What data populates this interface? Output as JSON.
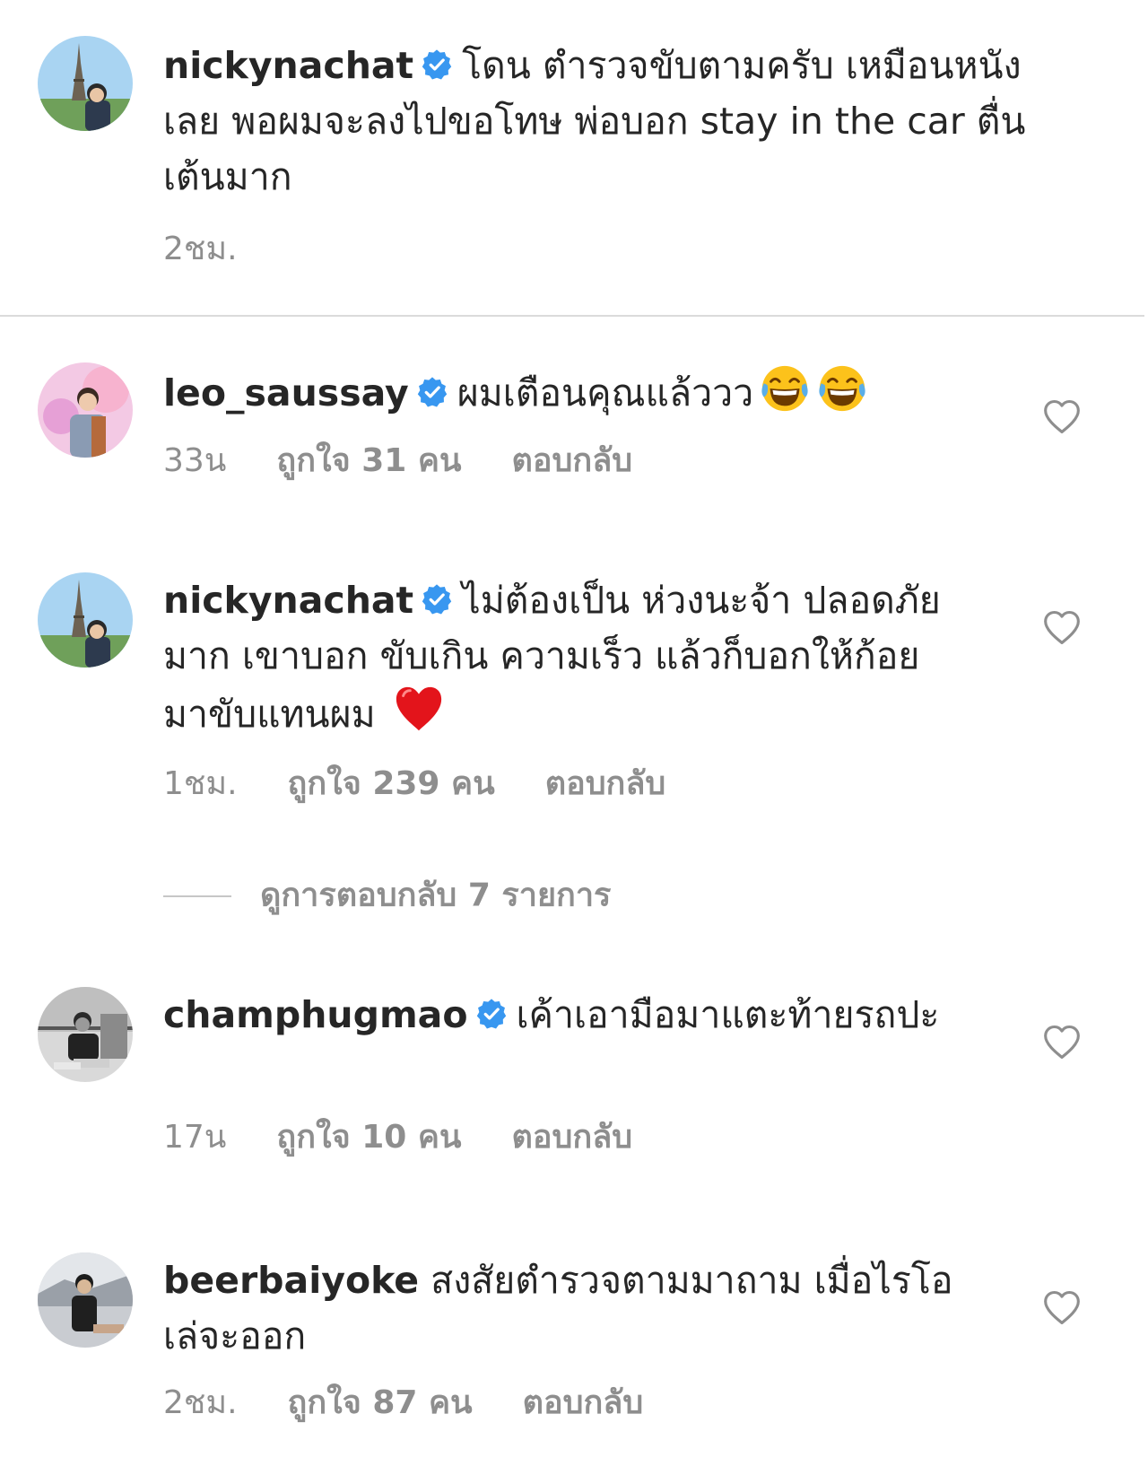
{
  "comments": [
    {
      "username": "nickynachat",
      "verified": true,
      "text": "โดน ตำรวจขับตามครับ เหมือนหนังเลย พอผมจะลงไปขอโทษ พ่อบอก stay in the car ตื่นเต้นมาก",
      "time": "2ชม.",
      "likes": "",
      "reply_label": "",
      "has_heart": false
    },
    {
      "username": "leo_saussay",
      "verified": true,
      "text": "ผมเตือนคุณแล้ววว",
      "emojis": [
        "tears-of-joy-emoji",
        "tears-of-joy-emoji"
      ],
      "time": "33น",
      "likes": "ถูกใจ 31 คน",
      "reply_label": "ตอบกลับ",
      "has_heart": true
    },
    {
      "username": "nickynachat",
      "verified": true,
      "text": "ไม่ต้องเป็น ห่วงนะจ้า ปลอดภัยมาก เขาบอก ขับเกิน ความเร็ว แล้วก็บอกให้ก้อยมาขับแทนผม",
      "emojis": [
        "red-heart-emoji"
      ],
      "time": "1ชม.",
      "likes": "ถูกใจ 239 คน",
      "reply_label": "ตอบกลับ",
      "has_heart": true,
      "view_replies": "ดูการตอบกลับ 7 รายการ"
    },
    {
      "username": "champhugmao",
      "verified": true,
      "text": "เค้าเอามือมาแตะท้ายรถปะ",
      "time": "17น",
      "likes": "ถูกใจ 10 คน",
      "reply_label": "ตอบกลับ",
      "has_heart": true
    },
    {
      "username": "beerbaiyoke",
      "verified": false,
      "text": "สงสัยตำรวจตามมาถาม  เมื่อไรโอเล่จะออก",
      "time": "2ชม.",
      "likes": "ถูกใจ 87 คน",
      "reply_label": "ตอบกลับ",
      "has_heart": true
    }
  ],
  "colors": {
    "verified": "#3897f0",
    "meta_text": "#8e8e8e",
    "primary_text": "#262626",
    "divider": "#dbdbdb"
  },
  "icons": [
    "verified-badge-icon",
    "heart-outline-icon",
    "tears-of-joy-emoji",
    "red-heart-emoji"
  ]
}
